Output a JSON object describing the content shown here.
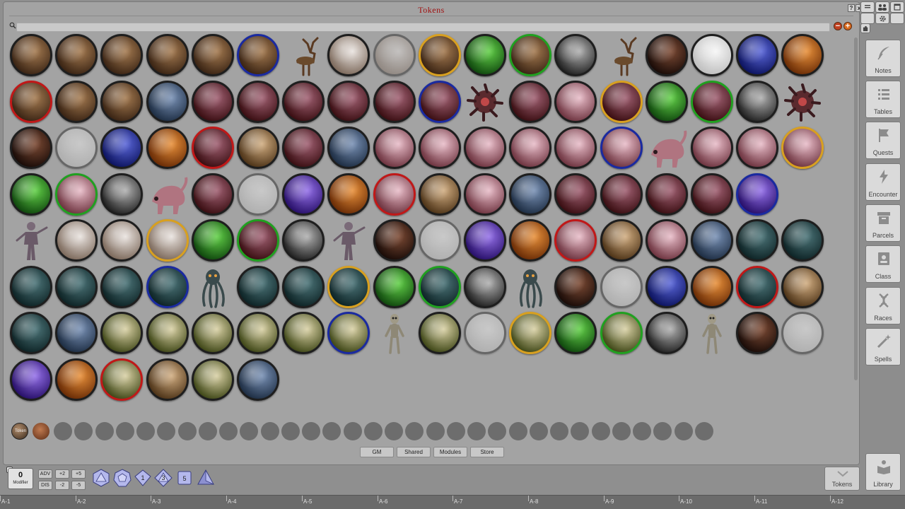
{
  "window": {
    "title": "Tokens",
    "help_label": "?",
    "close_label": "x"
  },
  "search": {
    "placeholder": "",
    "minus_label": "−",
    "plus_label": "+"
  },
  "token_colors": {
    "brown": [
      "#3a2414",
      "#a47a50"
    ],
    "pale": [
      "#7d6a5c",
      "#e9e3df"
    ],
    "white": [
      "#bfbfbf",
      "#f6f6f6"
    ],
    "blue": [
      "#0d1460",
      "#5a66d8"
    ],
    "slate": [
      "#1e2e44",
      "#7890b4"
    ],
    "orange": [
      "#6a2c06",
      "#e8903a"
    ],
    "green": [
      "#10480e",
      "#62d048"
    ],
    "gray": [
      "#242424",
      "#b0b0b0"
    ],
    "dark": [
      "#1a0c08",
      "#7c4a34"
    ],
    "maroon": [
      "#3a0e12",
      "#a06072"
    ],
    "pink": [
      "#6e3440",
      "#e8bcc8"
    ],
    "purple": [
      "#28106a",
      "#9470e8"
    ],
    "tan": [
      "#4e3418",
      "#d0ac80"
    ],
    "teal": [
      "#0e2426",
      "#4c7478"
    ],
    "olive": [
      "#404818",
      "#d8d0a4"
    ]
  },
  "border_colors": {
    "black": "#1e1e1e",
    "blue": "#1a2aa0",
    "gold": "#d8a020",
    "green": "#20a020",
    "red": "#c01818"
  },
  "token_rows": [
    [
      [
        "brown",
        "black"
      ],
      [
        "brown",
        "black"
      ],
      [
        "brown",
        "black"
      ],
      [
        "brown",
        "black"
      ],
      [
        "brown",
        "black"
      ],
      [
        "brown",
        "blue"
      ],
      [
        "fig",
        "stag"
      ],
      [
        "pale",
        "black"
      ],
      [
        "pale",
        "black",
        1
      ],
      [
        "brown",
        "gold"
      ],
      [
        "green",
        "black"
      ],
      [
        "brown",
        "green"
      ],
      [
        "gray",
        "black"
      ],
      [
        "fig",
        "stag"
      ],
      [
        "dark",
        "black"
      ],
      [
        "white",
        "black"
      ],
      [
        "blue",
        "black"
      ],
      [
        "orange",
        "black"
      ]
    ],
    [
      [
        "brown",
        "red"
      ],
      [
        "brown",
        "black"
      ],
      [
        "brown",
        "black"
      ],
      [
        "slate",
        "black"
      ],
      [
        "maroon",
        "black"
      ],
      [
        "maroon",
        "black"
      ],
      [
        "maroon",
        "black"
      ],
      [
        "maroon",
        "black"
      ],
      [
        "maroon",
        "black"
      ],
      [
        "maroon",
        "blue"
      ],
      [
        "fig",
        "blob"
      ],
      [
        "maroon",
        "black"
      ],
      [
        "pink",
        "black"
      ],
      [
        "maroon",
        "gold"
      ],
      [
        "green",
        "black"
      ],
      [
        "maroon",
        "green"
      ],
      [
        "gray",
        "black"
      ],
      [
        "fig",
        "blob"
      ]
    ],
    [
      [
        "dark",
        "black"
      ],
      [
        "white",
        "black",
        1
      ],
      [
        "blue",
        "black"
      ],
      [
        "orange",
        "black"
      ],
      [
        "maroon",
        "red"
      ],
      [
        "tan",
        "black"
      ],
      [
        "maroon",
        "black"
      ],
      [
        "slate",
        "black"
      ],
      [
        "pink",
        "black"
      ],
      [
        "pink",
        "black"
      ],
      [
        "pink",
        "black"
      ],
      [
        "pink",
        "black"
      ],
      [
        "pink",
        "black"
      ],
      [
        "pink",
        "blue"
      ],
      [
        "fig",
        "beast"
      ],
      [
        "pink",
        "black"
      ],
      [
        "pink",
        "black"
      ],
      [
        "pink",
        "gold"
      ]
    ],
    [
      [
        "green",
        "black"
      ],
      [
        "pink",
        "green"
      ],
      [
        "gray",
        "black"
      ],
      [
        "fig",
        "beast"
      ],
      [
        "maroon",
        "black"
      ],
      [
        "white",
        "black",
        1
      ],
      [
        "purple",
        "black"
      ],
      [
        "orange",
        "black"
      ],
      [
        "pink",
        "red"
      ],
      [
        "tan",
        "black"
      ],
      [
        "pink",
        "black"
      ],
      [
        "slate",
        "black"
      ],
      [
        "maroon",
        "black"
      ],
      [
        "maroon",
        "black"
      ],
      [
        "maroon",
        "black"
      ],
      [
        "maroon",
        "black"
      ],
      [
        "purple",
        "blue"
      ]
    ],
    [
      [
        "fig",
        "humanoid"
      ],
      [
        "pale",
        "black"
      ],
      [
        "pale",
        "black"
      ],
      [
        "pale",
        "gold"
      ],
      [
        "green",
        "black"
      ],
      [
        "maroon",
        "green"
      ],
      [
        "gray",
        "black"
      ],
      [
        "fig",
        "humanoid"
      ],
      [
        "dark",
        "black"
      ],
      [
        "white",
        "black",
        1
      ],
      [
        "purple",
        "black"
      ],
      [
        "orange",
        "black"
      ],
      [
        "pink",
        "red"
      ],
      [
        "tan",
        "black"
      ],
      [
        "pink",
        "black"
      ],
      [
        "slate",
        "black"
      ],
      [
        "teal",
        "black"
      ],
      [
        "teal",
        "black"
      ]
    ],
    [
      [
        "teal",
        "black"
      ],
      [
        "teal",
        "black"
      ],
      [
        "teal",
        "black"
      ],
      [
        "teal",
        "blue"
      ],
      [
        "fig",
        "tentacle"
      ],
      [
        "teal",
        "black"
      ],
      [
        "teal",
        "black"
      ],
      [
        "teal",
        "gold"
      ],
      [
        "green",
        "black"
      ],
      [
        "teal",
        "green"
      ],
      [
        "gray",
        "black"
      ],
      [
        "fig",
        "tentacle"
      ],
      [
        "dark",
        "black"
      ],
      [
        "white",
        "black",
        1
      ],
      [
        "blue",
        "black"
      ],
      [
        "orange",
        "black"
      ],
      [
        "teal",
        "red"
      ],
      [
        "tan",
        "black"
      ]
    ],
    [
      [
        "teal",
        "black"
      ],
      [
        "slate",
        "black"
      ],
      [
        "olive",
        "black"
      ],
      [
        "olive",
        "black"
      ],
      [
        "olive",
        "black"
      ],
      [
        "olive",
        "black"
      ],
      [
        "olive",
        "black"
      ],
      [
        "olive",
        "blue"
      ],
      [
        "fig",
        "alien"
      ],
      [
        "olive",
        "black"
      ],
      [
        "white",
        "black",
        1
      ],
      [
        "olive",
        "gold"
      ],
      [
        "green",
        "black"
      ],
      [
        "olive",
        "green"
      ],
      [
        "gray",
        "black"
      ],
      [
        "fig",
        "alien"
      ],
      [
        "dark",
        "black"
      ],
      [
        "white",
        "black",
        1
      ]
    ],
    [
      [
        "purple",
        "black"
      ],
      [
        "orange",
        "black"
      ],
      [
        "olive",
        "red"
      ],
      [
        "tan",
        "black"
      ],
      [
        "olive",
        "black"
      ],
      [
        "slate",
        "black"
      ]
    ]
  ],
  "bag": {
    "token_label": "Token",
    "empty_slots": 32
  },
  "tabs": [
    "GM",
    "Shared",
    "Modules",
    "Store"
  ],
  "sidebar": [
    {
      "label": "Notes",
      "icon": "feather-icon"
    },
    {
      "label": "Tables",
      "icon": "list-icon"
    },
    {
      "label": "Quests",
      "icon": "flag-icon"
    },
    {
      "label": "Encounter",
      "icon": "lightning-icon"
    },
    {
      "label": "Parcels",
      "icon": "box-icon"
    },
    {
      "label": "Class",
      "icon": "person-card-icon"
    },
    {
      "label": "Races",
      "icon": "dna-icon"
    },
    {
      "label": "Spells",
      "icon": "wand-icon"
    }
  ],
  "dock": {
    "tokens_label": "Tokens",
    "library_label": "Library"
  },
  "modifier": {
    "value": "0",
    "label": "Modifier",
    "adv": "ADV",
    "dis": "DIS",
    "plus2": "+2",
    "plus5": "+5",
    "minus2": "-2",
    "minus5": "-5"
  },
  "dice": [
    "",
    "",
    "1",
    "3",
    "5",
    ""
  ],
  "ruler": [
    "A-1",
    "A-2",
    "A-3",
    "A-4",
    "A-5",
    "A-6",
    "A-7",
    "A-8",
    "A-9",
    "A-10",
    "A-11",
    "A-12"
  ]
}
